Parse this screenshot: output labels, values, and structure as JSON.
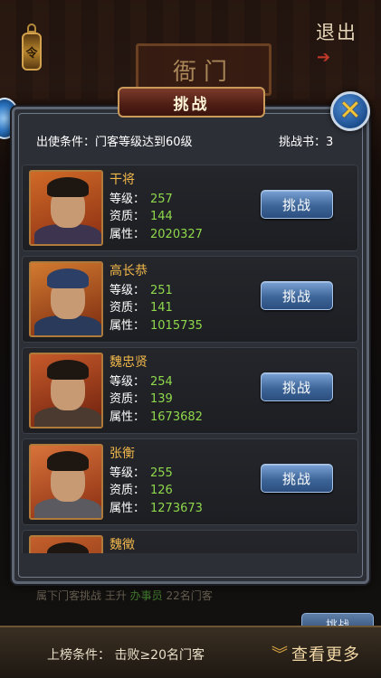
{
  "scene": {
    "gate_sign": "衙门",
    "exit_label": "退出",
    "lantern_glyph": "令",
    "left_icon": "gear-icon"
  },
  "modal": {
    "title": "挑战",
    "close_icon": "close-x-icon",
    "condition_label": "出使条件：",
    "condition_value": "门客等级达到60级",
    "books_label": "挑战书：",
    "books_count": "3",
    "stat_labels": {
      "level": "等级：",
      "quality": "资质：",
      "attribute": "属性："
    },
    "challenge_label": "挑战",
    "opponents": [
      {
        "name": "干将",
        "level": "257",
        "quality": "144",
        "attribute": "2020327"
      },
      {
        "name": "高长恭",
        "level": "251",
        "quality": "141",
        "attribute": "1015735"
      },
      {
        "name": "魏忠贤",
        "level": "254",
        "quality": "139",
        "attribute": "1673682"
      },
      {
        "name": "张衡",
        "level": "255",
        "quality": "126",
        "attribute": "1273673"
      },
      {
        "name": "魏徵"
      }
    ]
  },
  "background": {
    "ticker_text": "属下门客挑战 王升",
    "ticker_highlight": "办事员",
    "ticker_tail": "22名门客",
    "challenge_label": "挑战"
  },
  "bottom_bar": {
    "rank_condition": "上榜条件：  击败≥20名门客",
    "view_more": "查看更多",
    "view_more_icon": "double-chevron-down-icon"
  },
  "colors": {
    "name_gold": "#f0b64a",
    "value_green": "#8fd84c",
    "button_blue": "#3e6699",
    "panel_bg": "#2c2f36"
  }
}
